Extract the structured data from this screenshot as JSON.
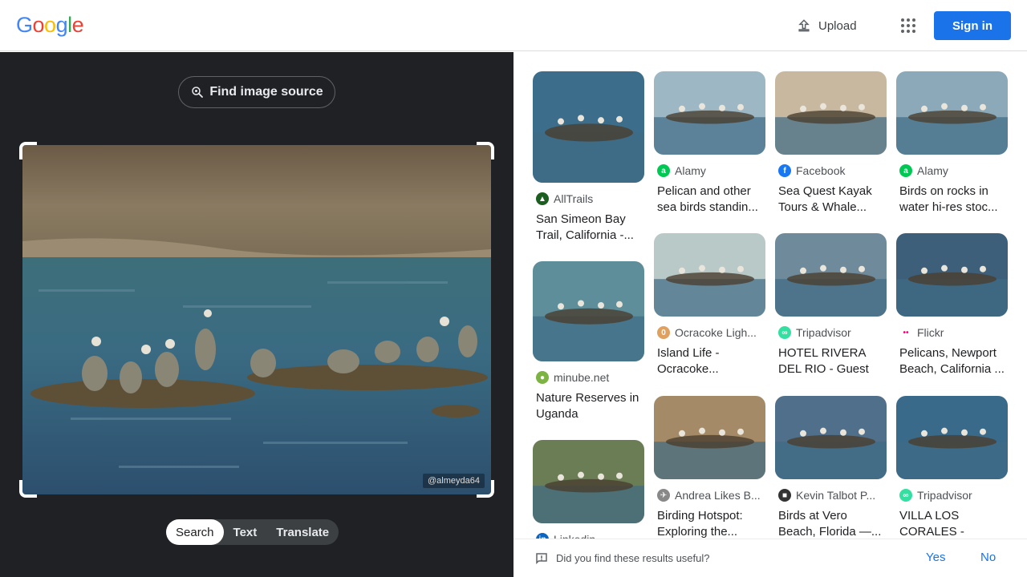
{
  "header": {
    "logo_letters": [
      "G",
      "o",
      "o",
      "g",
      "l",
      "e"
    ],
    "logo_colors": [
      "#4285F4",
      "#EA4335",
      "#FBBC05",
      "#4285F4",
      "#34A853",
      "#EA4335"
    ],
    "upload_label": "Upload",
    "apps_icon": "apps-grid-icon",
    "signin_label": "Sign in"
  },
  "lens": {
    "find_source_label": "Find image source",
    "watermark": "@almeyda64",
    "tabs": [
      "Search",
      "Text",
      "Translate"
    ],
    "active_tab": "Search"
  },
  "results": {
    "col1": [
      {
        "source": "AllTrails",
        "title": "San Simeon Bay Trail, California -...",
        "favicon_color": "#1b5e20",
        "favicon_glyph": "▲"
      },
      {
        "source": "minube.net",
        "title": "Nature Reserves in Uganda",
        "favicon_color": "#7cb342",
        "favicon_glyph": "●"
      },
      {
        "source": "Linkedin",
        "title": "",
        "favicon_color": "#0a66c2",
        "favicon_glyph": "in"
      }
    ],
    "col2": [
      {
        "source": "Alamy",
        "title": "Pelican and other sea birds standin...",
        "favicon_color": "#00c853",
        "favicon_glyph": "a"
      },
      {
        "source": "Ocracoke Ligh...",
        "title": "Island Life - Ocracoke...",
        "favicon_color": "#e0a060",
        "favicon_glyph": "0"
      },
      {
        "source": "Andrea Likes B...",
        "title": "Birding Hotspot: Exploring the...",
        "favicon_color": "#888888",
        "favicon_glyph": "✈"
      }
    ],
    "col3": [
      {
        "source": "Facebook",
        "title": "Sea Quest Kayak Tours & Whale...",
        "favicon_color": "#1877f2",
        "favicon_glyph": "f"
      },
      {
        "source": "Tripadvisor",
        "title": "HOTEL RIVERA DEL RIO - Guest hous...",
        "favicon_color": "#34e0a1",
        "favicon_glyph": "∞"
      },
      {
        "source": "Kevin Talbot P...",
        "title": "Birds at Vero Beach, Florida —...",
        "favicon_color": "#333333",
        "favicon_glyph": "■"
      }
    ],
    "col4": [
      {
        "source": "Alamy",
        "title": "Birds on rocks in water hi-res stoc...",
        "favicon_color": "#00c853",
        "favicon_glyph": "a"
      },
      {
        "source": "Flickr",
        "title": "Pelicans, Newport Beach, California ...",
        "favicon_color": "#ffffff",
        "favicon_glyph": "••"
      },
      {
        "source": "Tripadvisor",
        "title": "VILLA LOS CORALES - Prices...",
        "favicon_color": "#34e0a1",
        "favicon_glyph": "∞"
      }
    ]
  },
  "feedback": {
    "question": "Did you find these results useful?",
    "yes": "Yes",
    "no": "No"
  }
}
